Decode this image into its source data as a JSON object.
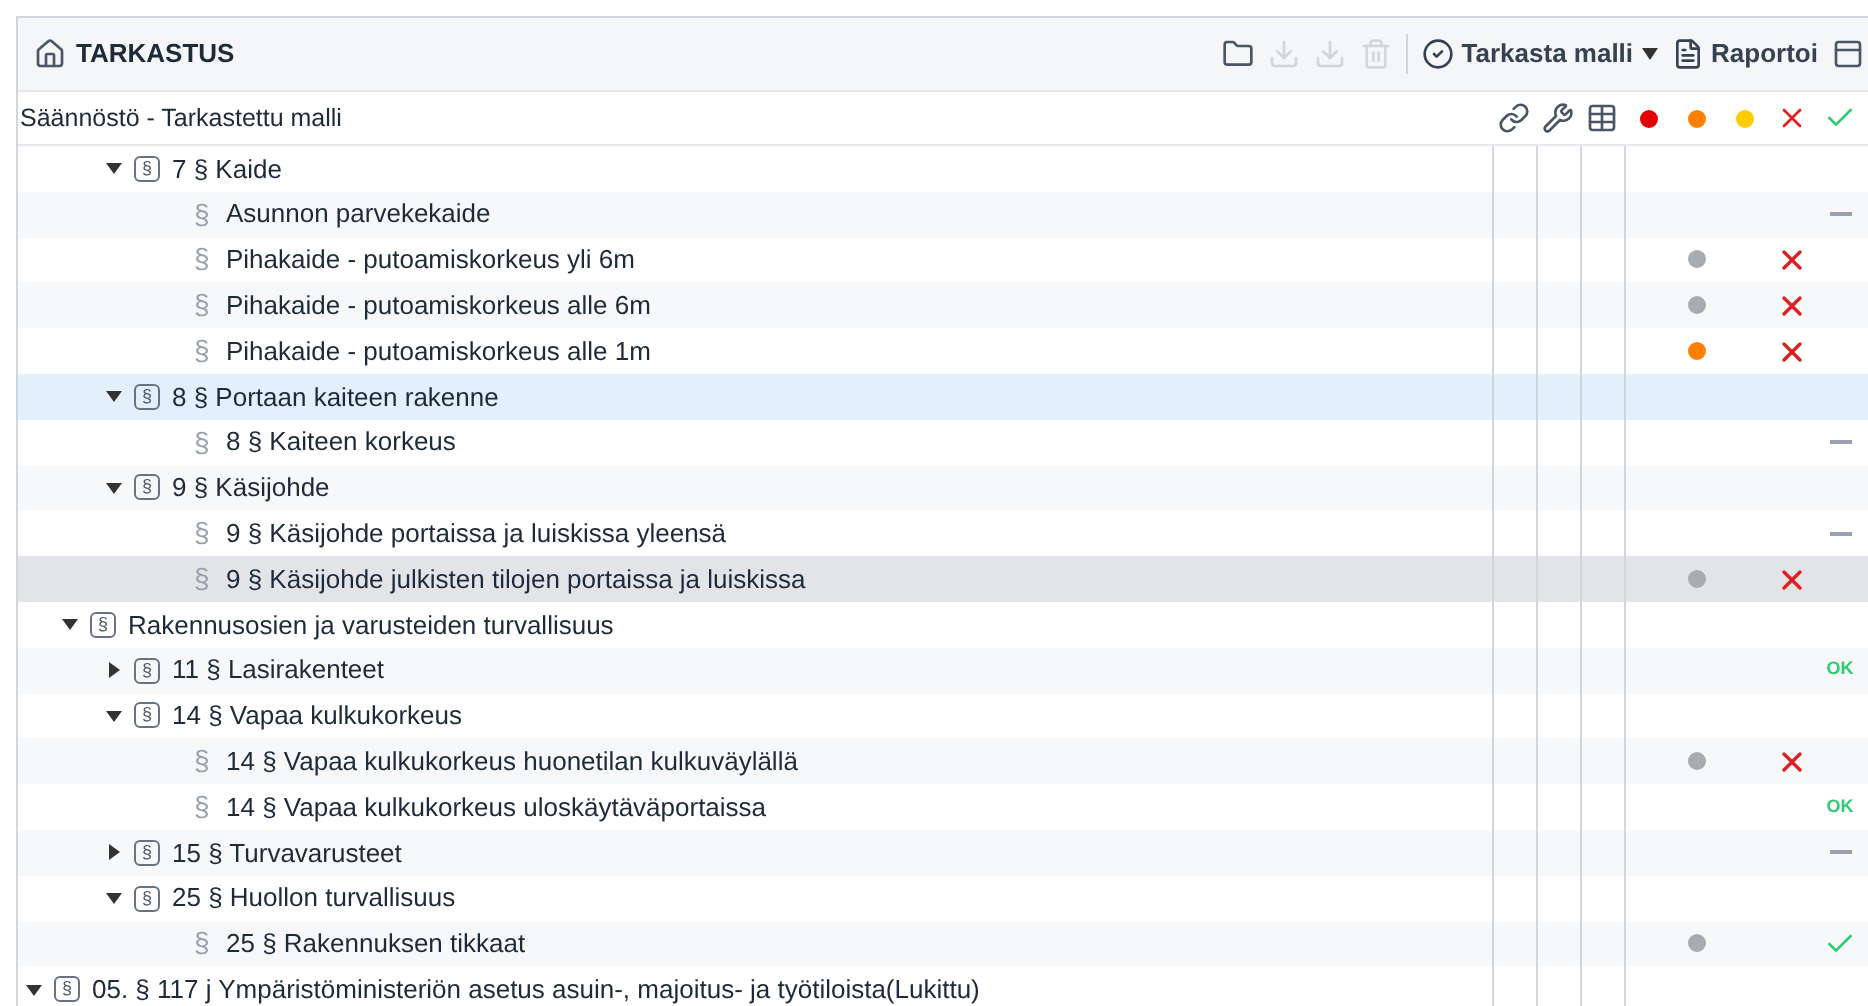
{
  "panel": {
    "title": "TARKASTUS"
  },
  "toolbar": [
    {
      "kind": "folder",
      "disabled": false
    },
    {
      "kind": "download",
      "disabled": true
    },
    {
      "kind": "download",
      "disabled": true
    },
    {
      "kind": "trash",
      "disabled": true
    },
    {
      "kind": "divider"
    },
    {
      "kind": "check",
      "label": "Tarkasta malli",
      "dropdown": true,
      "disabled": false
    },
    {
      "kind": "report",
      "label": "Raportoi",
      "disabled": false
    },
    {
      "kind": "panel",
      "disabled": false
    }
  ],
  "table": {
    "title": "Säännöstö - Tarkastettu malli",
    "columns": [
      {
        "kind": "link"
      },
      {
        "kind": "wrench"
      },
      {
        "kind": "table"
      },
      {
        "kind": "dot",
        "color": "#e00000"
      },
      {
        "kind": "dot",
        "color": "#ff8000"
      },
      {
        "kind": "dot",
        "color": "#ffcc00"
      },
      {
        "kind": "cross"
      },
      {
        "kind": "check"
      }
    ],
    "tree": [
      {
        "children": [
          {
            "children": [
              {
                "label": "7 § Kaide",
                "glyph": "§",
                "expanded": true,
                "selected": false,
                "hovered": false,
                "children": [
                  {
                    "label": "Asunnon parvekekaide",
                    "glyph": "§",
                    "selected": false,
                    "hovered": false,
                    "status": {
                      "kind": "dash"
                    }
                  },
                  {
                    "label": "Pihakaide - putoamiskorkeus yli 6m",
                    "glyph": "§",
                    "selected": false,
                    "hovered": false,
                    "dot": {
                      "color": "#a8abb0"
                    },
                    "status": {
                      "kind": "cross"
                    }
                  },
                  {
                    "label": "Pihakaide - putoamiskorkeus alle 6m",
                    "glyph": "§",
                    "selected": false,
                    "hovered": false,
                    "dot": {
                      "color": "#a8abb0"
                    },
                    "status": {
                      "kind": "cross"
                    }
                  },
                  {
                    "label": "Pihakaide - putoamiskorkeus alle 1m",
                    "glyph": "§",
                    "selected": false,
                    "hovered": false,
                    "dot": {
                      "color": "#ff8000"
                    },
                    "status": {
                      "kind": "cross"
                    }
                  }
                ]
              },
              {
                "label": "8 § Portaan kaiteen rakenne",
                "glyph": "§",
                "expanded": true,
                "selected": true,
                "hovered": false,
                "children": [
                  {
                    "label": "8 § Kaiteen korkeus",
                    "glyph": "§",
                    "selected": false,
                    "hovered": false,
                    "status": {
                      "kind": "dash"
                    }
                  }
                ]
              },
              {
                "label": "9 § Käsijohde",
                "glyph": "§",
                "expanded": true,
                "selected": false,
                "hovered": false,
                "children": [
                  {
                    "label": "9 § Käsijohde portaissa ja luiskissa yleensä",
                    "glyph": "§",
                    "selected": false,
                    "hovered": false,
                    "status": {
                      "kind": "dash"
                    }
                  },
                  {
                    "label": "9 § Käsijohde julkisten tilojen portaissa ja luiskissa",
                    "glyph": "§",
                    "selected": false,
                    "hovered": true,
                    "dot": {
                      "color": "#a8abb0"
                    },
                    "status": {
                      "kind": "cross"
                    }
                  }
                ]
              }
            ]
          },
          {
            "label": "Rakennusosien ja varusteiden turvallisuus",
            "glyph": "§",
            "expanded": true,
            "selected": false,
            "hovered": false,
            "children": [
              {
                "label": "11 § Lasirakenteet",
                "glyph": "§",
                "expanded": false,
                "selected": false,
                "hovered": false,
                "status": {
                  "kind": "label",
                  "text": "OK"
                }
              },
              {
                "label": "14 § Vapaa kulkukorkeus",
                "glyph": "§",
                "expanded": true,
                "selected": false,
                "hovered": false,
                "children": [
                  {
                    "label": "14 § Vapaa kulkukorkeus huonetilan kulkuväylällä",
                    "glyph": "§",
                    "selected": false,
                    "hovered": false,
                    "dot": {
                      "color": "#a8abb0"
                    },
                    "status": {
                      "kind": "cross"
                    }
                  },
                  {
                    "label": "14 § Vapaa kulkukorkeus uloskäytäväportaissa",
                    "glyph": "§",
                    "selected": false,
                    "hovered": false,
                    "status": {
                      "kind": "label",
                      "text": "OK"
                    }
                  }
                ]
              },
              {
                "label": "15 § Turvavarusteet",
                "glyph": "§",
                "expanded": false,
                "selected": false,
                "hovered": false,
                "status": {
                  "kind": "dash"
                }
              },
              {
                "label": "25 § Huollon turvallisuus",
                "glyph": "§",
                "expanded": true,
                "selected": false,
                "hovered": false,
                "children": [
                  {
                    "label": "25 § Rakennuksen tikkaat",
                    "glyph": "§",
                    "selected": false,
                    "hovered": false,
                    "dot": {
                      "color": "#a8abb0"
                    },
                    "status": {
                      "kind": "check"
                    }
                  }
                ]
              }
            ]
          }
        ]
      },
      {
        "label": "05. § 117 j Ympäristöministeriön asetus asuin-, majoitus- ja työtiloista(Lukittu)",
        "glyph": "§",
        "expanded": true,
        "selected": false,
        "hovered": false
      }
    ]
  }
}
